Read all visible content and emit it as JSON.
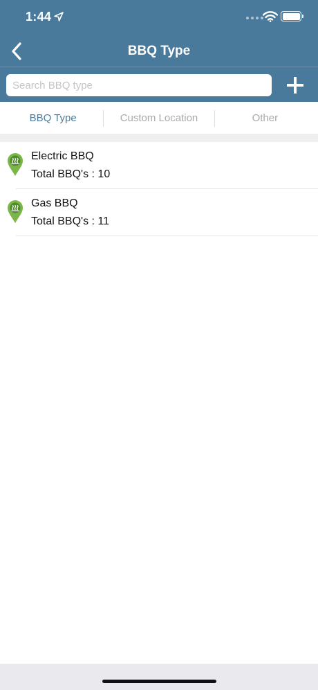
{
  "status_bar": {
    "time": "1:44",
    "icons": [
      "location-arrow-icon",
      "cellular-signal-icon",
      "wifi-icon",
      "battery-icon"
    ]
  },
  "nav": {
    "title": "BBQ Type",
    "back_icon": "chevron-left-icon"
  },
  "search": {
    "placeholder": "Search BBQ type",
    "value": "",
    "add_icon": "plus-icon"
  },
  "tabs": [
    {
      "label": "BBQ Type",
      "active": true
    },
    {
      "label": "Custom Location",
      "active": false
    },
    {
      "label": "Other",
      "active": false
    }
  ],
  "items": [
    {
      "name": "Electric BBQ",
      "count_text": "Total BBQ's : 10",
      "icon": "bbq-pin-icon"
    },
    {
      "name": "Gas BBQ",
      "count_text": "Total BBQ's : 11",
      "icon": "bbq-pin-icon"
    }
  ],
  "colors": {
    "header": "#4a7a9b",
    "active_tab": "#4a7a9b",
    "inactive_tab": "#a9a9a9",
    "pin": "#7ab648",
    "pin_dark": "#4f8a2a"
  }
}
